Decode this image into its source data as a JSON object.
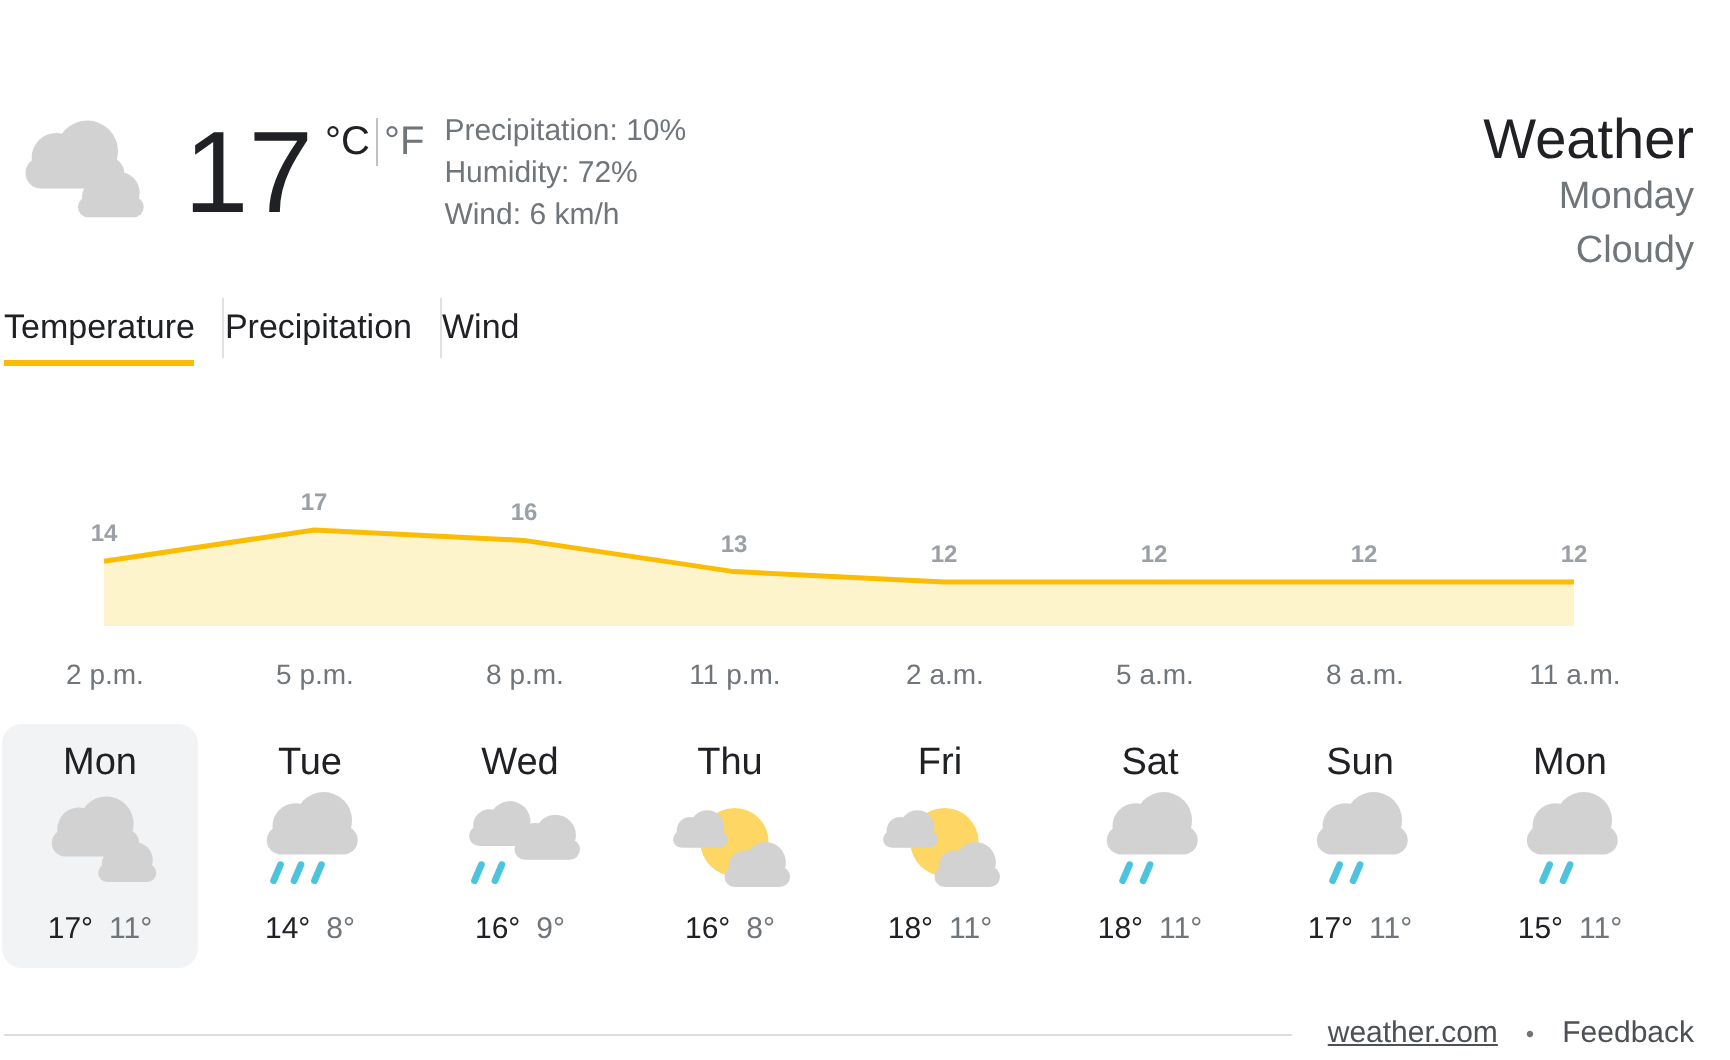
{
  "current": {
    "kind": "cloudy",
    "temperature": "17",
    "units": [
      {
        "label": "°C",
        "selected": true
      },
      {
        "label": "°F",
        "selected": false
      }
    ],
    "details": [
      "Precipitation: 10%",
      "Humidity: 72%",
      "Wind: 6 km/h"
    ]
  },
  "header": {
    "title": "Weather",
    "day": "Monday",
    "condition": "Cloudy"
  },
  "tabs": [
    {
      "label": "Temperature",
      "selected": true
    },
    {
      "label": "Precipitation",
      "selected": false
    },
    {
      "label": "Wind",
      "selected": false
    }
  ],
  "chart_data": {
    "type": "area",
    "categories": [
      "2 p.m.",
      "5 p.m.",
      "8 p.m.",
      "11 p.m.",
      "2 a.m.",
      "5 a.m.",
      "8 a.m.",
      "11 a.m."
    ],
    "series": [
      {
        "color": "#fbbc04",
        "values": [
          14,
          17,
          16,
          13,
          12,
          12,
          12,
          12
        ]
      }
    ],
    "data_labels": true
  },
  "days": [
    {
      "day": "Mon",
      "kind": "cloudy",
      "high": "17°",
      "low": "11°",
      "selected": true
    },
    {
      "day": "Tue",
      "kind": "heavy-rain",
      "high": "14°",
      "low": "8°",
      "selected": false
    },
    {
      "day": "Wed",
      "kind": "rain-and-clouds",
      "high": "16°",
      "low": "9°",
      "selected": false
    },
    {
      "day": "Thu",
      "kind": "sun-and-clouds",
      "high": "16°",
      "low": "8°",
      "selected": false
    },
    {
      "day": "Fri",
      "kind": "sun-and-clouds",
      "high": "18°",
      "low": "11°",
      "selected": false
    },
    {
      "day": "Sat",
      "kind": "light-rain",
      "high": "18°",
      "low": "11°",
      "selected": false
    },
    {
      "day": "Sun",
      "kind": "light-rain",
      "high": "17°",
      "low": "11°",
      "selected": false
    },
    {
      "day": "Mon",
      "kind": "light-rain",
      "high": "15°",
      "low": "11°",
      "selected": false
    }
  ],
  "footer": {
    "source": "weather.com",
    "separator": "•",
    "feedback": "Feedback"
  }
}
